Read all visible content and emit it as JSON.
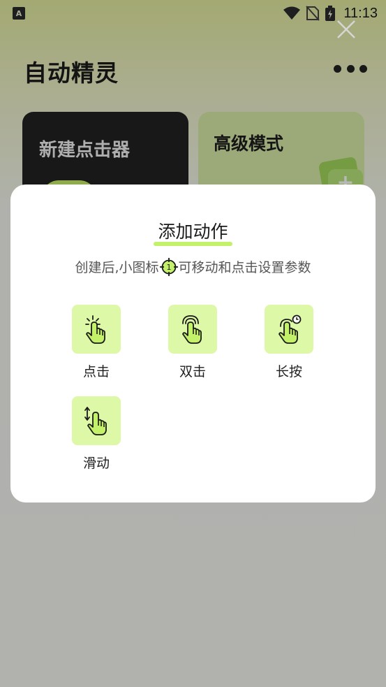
{
  "status_bar": {
    "app_icon_letter": "A",
    "time": "11:13"
  },
  "app": {
    "title": "自动精灵",
    "cards": {
      "new_clicker": "新建点击器",
      "advanced_mode": "高级模式"
    }
  },
  "dialog": {
    "title": "添加动作",
    "hint_before": "创建后,小图标",
    "hint_after": "可移动和点击设置参数",
    "actions": [
      {
        "label": "点击",
        "icon": "tap-hand-icon"
      },
      {
        "label": "双击",
        "icon": "double-tap-hand-icon"
      },
      {
        "label": "长按",
        "icon": "long-press-hand-icon"
      },
      {
        "label": "滑动",
        "icon": "swipe-hand-icon"
      }
    ]
  },
  "colors": {
    "accent_green": "#c3f26a",
    "tile_green": "#ddf8a6",
    "dark_card": "#222222"
  }
}
